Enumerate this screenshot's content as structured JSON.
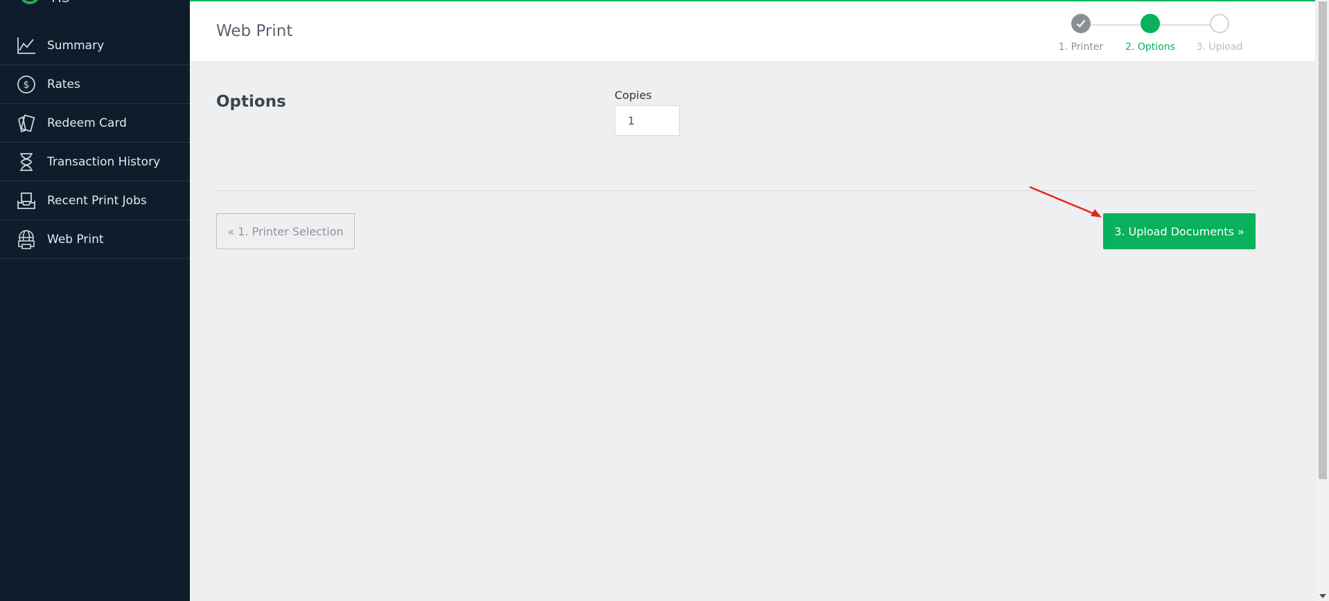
{
  "sidebar": {
    "logo_text": "ris",
    "items": [
      {
        "label": "Summary",
        "icon": "chart-line-icon"
      },
      {
        "label": "Rates",
        "icon": "dollar-circle-icon"
      },
      {
        "label": "Redeem Card",
        "icon": "cards-icon"
      },
      {
        "label": "Transaction History",
        "icon": "hourglass-icon"
      },
      {
        "label": "Recent Print Jobs",
        "icon": "inbox-tray-icon"
      },
      {
        "label": "Web Print",
        "icon": "globe-printer-icon"
      }
    ]
  },
  "header": {
    "title": "Web Print",
    "steps": [
      {
        "label": "1. Printer",
        "state": "done"
      },
      {
        "label": "2. Options",
        "state": "active"
      },
      {
        "label": "3. Upload",
        "state": "pending"
      }
    ]
  },
  "options": {
    "title": "Options",
    "copies_label": "Copies",
    "copies_value": "1"
  },
  "actions": {
    "prev_label": "« 1. Printer Selection",
    "next_label": "3. Upload Documents »"
  },
  "colors": {
    "accent": "#08b15a",
    "sidebar_bg": "#0f1c2b",
    "annotation_arrow": "#e52420"
  }
}
